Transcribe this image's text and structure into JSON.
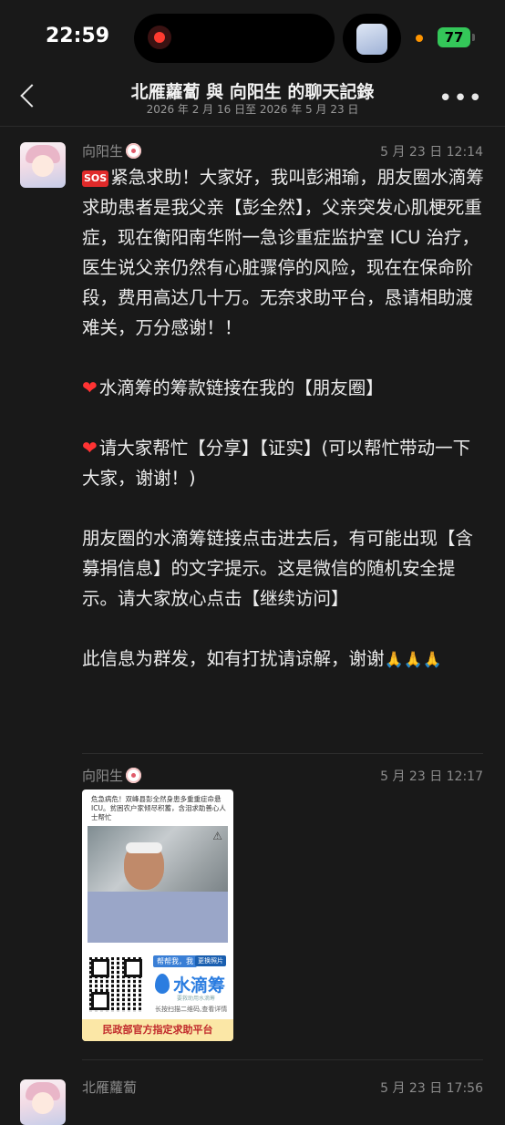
{
  "status_bar": {
    "time": "22:59",
    "battery": "77"
  },
  "header": {
    "title": "北雁蘿蔔 與 向阳生 的聊天記錄",
    "subtitle": "2026 年 2 月 16 日至 2026 年 5 月 23 日",
    "more_label": "•••"
  },
  "messages": [
    {
      "sender": "向阳生",
      "time": "5 月 23 日 12:14",
      "badge": "SOS",
      "paragraphs": [
        "紧急求助！大家好，我叫彭湘瑜，朋友圈水滴筹求助患者是我父亲【彭全然】，父亲突发心肌梗死重症，现在衡阳南华附一急诊重症监护室 ICU 治疗，医生说父亲仍然有心脏骤停的风险，现在在保命阶段，费用高达几十万。无奈求助平台，恳请相助渡难关，万分感谢！！",
        "水滴筹的筹款链接在我的【朋友圈】",
        "请大家帮忙【分享】【证实】(可以帮忙带动一下大家，谢谢！)",
        "朋友圈的水滴筹链接点击进去后，有可能出现【含募捐信息】的文字提示。这是微信的随机安全提示。请大家放心点击【继续访问】",
        "此信息为群发，如有打扰请谅解，谢谢"
      ],
      "heart_glyph": "❤",
      "pray_glyph": "🙏🙏🙏"
    },
    {
      "sender": "向阳生",
      "time": "5 月 23 日 12:17",
      "card": {
        "caption": "危急病危！双峰县彭全然身患多重重症命悬ICU。贫困农户家倾尽积蓄，含泪求助善心人士帮忙",
        "help_tag": "帮帮我，我",
        "change_tag": "更换照片",
        "brand": "水滴筹",
        "brand_sub": "要救助用水滴筹",
        "scan_note": "长按扫描二维码,查看详情",
        "footer": "民政部官方指定求助平台"
      }
    },
    {
      "sender": "北雁蘿蔔",
      "time": "5 月 23 日 17:56"
    }
  ]
}
